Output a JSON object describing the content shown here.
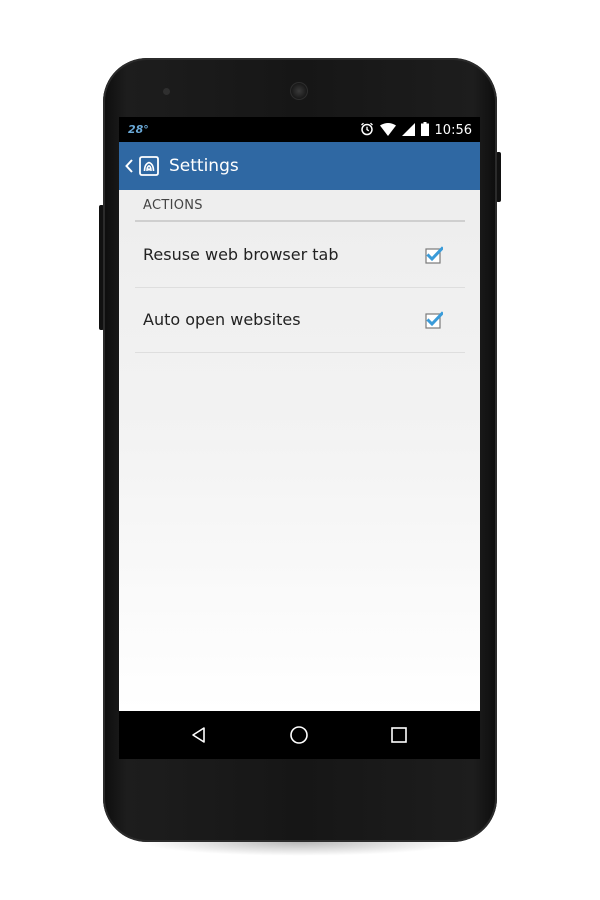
{
  "status_bar": {
    "temperature": "28°",
    "time": "10:56",
    "icons": [
      "alarm-icon",
      "wifi-icon",
      "signal-icon",
      "battery-icon"
    ]
  },
  "app_bar": {
    "title": "Settings",
    "back_icon": "chevron-left-icon",
    "logo_icon": "nfc-tag-logo-icon",
    "color": "#2f68a3"
  },
  "preferences": {
    "section_title": "ACTIONS",
    "items": [
      {
        "label": "Resuse web browser tab",
        "checked": true
      },
      {
        "label": "Auto open websites",
        "checked": true
      }
    ],
    "checkbox_color": "#3a9bd9"
  },
  "nav_bar": {
    "icons": [
      "back-triangle-icon",
      "home-circle-icon",
      "recent-apps-square-icon"
    ]
  }
}
